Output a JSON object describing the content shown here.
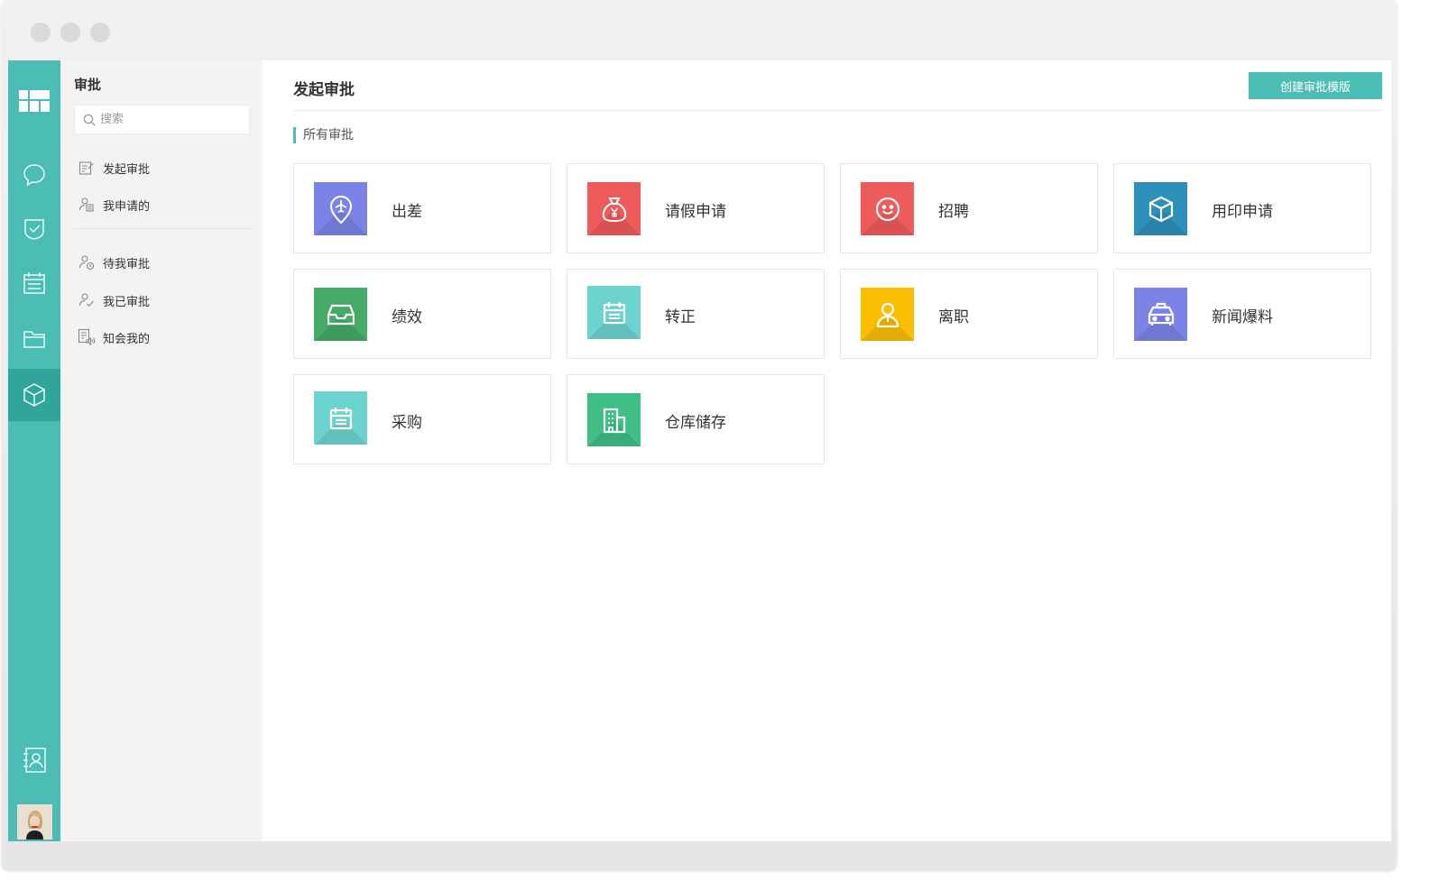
{
  "sidebar": {
    "title": "审批",
    "search_placeholder": "搜索",
    "items": [
      {
        "label": "发起审批"
      },
      {
        "label": "我申请的"
      },
      {
        "label": "待我审批"
      },
      {
        "label": "我已审批"
      },
      {
        "label": "知会我的"
      }
    ]
  },
  "main": {
    "title": "发起审批",
    "create_button": "创建审批模版",
    "section_label": "所有审批",
    "cards": [
      {
        "label": "出差",
        "color": "#7b83e6",
        "icon": "airplane-pin-icon"
      },
      {
        "label": "请假申请",
        "color": "#ee5b5b",
        "icon": "money-bag-icon"
      },
      {
        "label": "招聘",
        "color": "#ee5b5b",
        "icon": "smiley-icon"
      },
      {
        "label": "用印申请",
        "color": "#2e8fb8",
        "icon": "cube-icon"
      },
      {
        "label": "绩效",
        "color": "#45ab66",
        "icon": "inbox-icon"
      },
      {
        "label": "转正",
        "color": "#6dd3cf",
        "icon": "calendar-icon"
      },
      {
        "label": "离职",
        "color": "#fbbd00",
        "icon": "person-icon"
      },
      {
        "label": "新闻爆料",
        "color": "#7b83e6",
        "icon": "taxi-icon"
      },
      {
        "label": "采购",
        "color": "#6dd3cf",
        "icon": "calendar-icon"
      },
      {
        "label": "仓库储存",
        "color": "#3fbf86",
        "icon": "building-icon"
      }
    ]
  },
  "colors": {
    "accent": "#4bbdb5",
    "accent_dark": "#2fa59c"
  }
}
